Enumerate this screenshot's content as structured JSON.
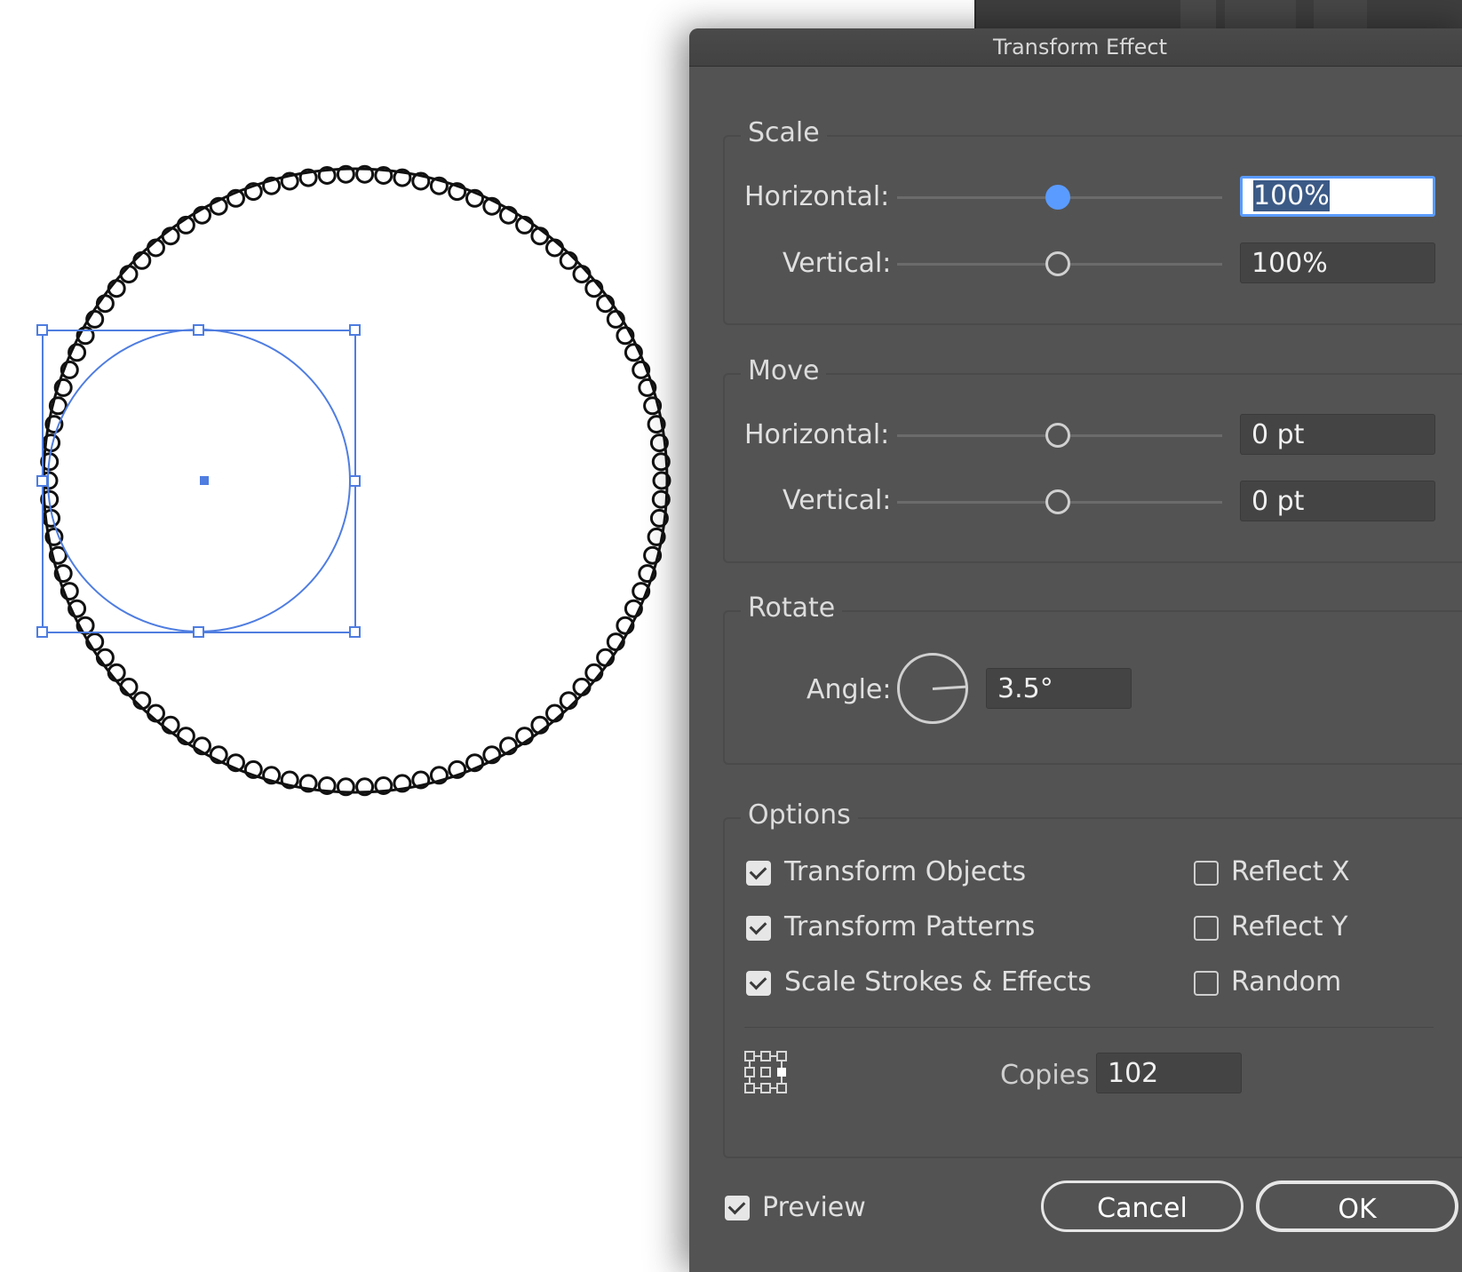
{
  "dialog": {
    "title": "Transform Effect",
    "scale": {
      "legend": "Scale",
      "horizontal_label": "Horizontal:",
      "horizontal_value": "100%",
      "vertical_label": "Vertical:",
      "vertical_value": "100%"
    },
    "move": {
      "legend": "Move",
      "horizontal_label": "Horizontal:",
      "horizontal_value": "0 pt",
      "vertical_label": "Vertical:",
      "vertical_value": "0 pt"
    },
    "rotate": {
      "legend": "Rotate",
      "angle_label": "Angle:",
      "angle_value": "3.5°"
    },
    "options": {
      "legend": "Options",
      "transform_objects": {
        "label": "Transform Objects",
        "checked": true
      },
      "transform_patterns": {
        "label": "Transform Patterns",
        "checked": true
      },
      "scale_strokes": {
        "label": "Scale Strokes & Effects",
        "checked": true
      },
      "reflect_x": {
        "label": "Reflect X",
        "checked": false
      },
      "reflect_y": {
        "label": "Reflect Y",
        "checked": false
      },
      "random": {
        "label": "Random",
        "checked": false
      },
      "copies_label": "Copies",
      "copies_value": "102",
      "reference_point_icon": "reference-point-grid-icon"
    },
    "preview": {
      "label": "Preview",
      "checked": true
    },
    "cancel_label": "Cancel",
    "ok_label": "OK"
  },
  "colors": {
    "dialog_bg": "#535353",
    "accent": "#5a9bff",
    "selection": "#4f7de0"
  }
}
